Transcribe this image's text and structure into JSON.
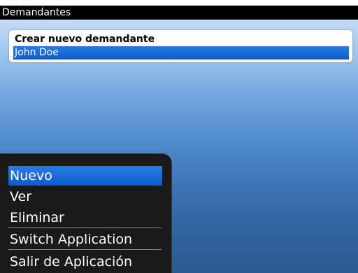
{
  "title_bar": {
    "title": "Demandantes"
  },
  "list": {
    "header": "Crear nuevo demandante",
    "items": [
      {
        "label": "John Doe",
        "selected": true
      }
    ]
  },
  "menu": {
    "items": [
      {
        "label": "Nuevo",
        "selected": true
      },
      {
        "label": "Ver",
        "selected": false
      },
      {
        "label": "Eliminar",
        "selected": false
      },
      {
        "label": "Switch Application",
        "selected": false
      },
      {
        "label": "Salir de Aplicación",
        "selected": false
      }
    ]
  },
  "colors": {
    "highlight": "#1565d8",
    "title_bar_bg": "#000000",
    "menu_bg": "#1a1a1a"
  }
}
